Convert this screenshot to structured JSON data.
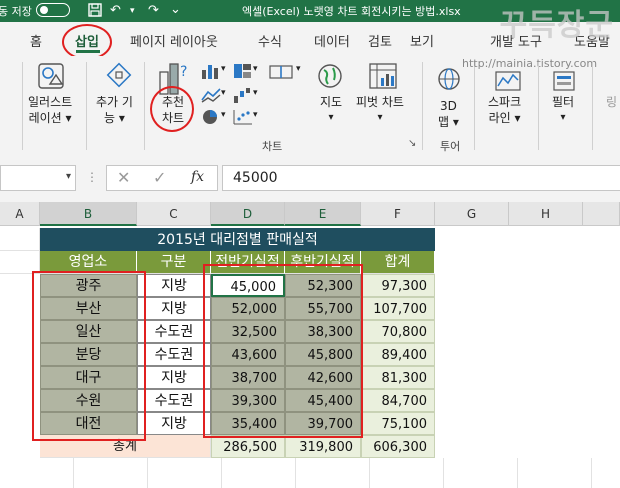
{
  "titlebar": {
    "autosave": "동 저장",
    "doc_title": "엑셀(Excel) 노랫영 차트 회전시키는 방법.xlsx"
  },
  "watermark": {
    "big": "꾸득장군",
    "url": "http://mainia.tistory.com"
  },
  "tabs": [
    "홈",
    "삽입",
    "페이지 레이아웃",
    "수식",
    "데이터",
    "검토",
    "보기",
    "개발 도구",
    "도움말"
  ],
  "ribbon": {
    "illustrations": [
      "일러스트",
      "레이션 ▾"
    ],
    "addins": [
      "추가 기",
      "능 ▾"
    ],
    "recommended": [
      "추천",
      "차트"
    ],
    "maps": [
      "지도",
      "▾"
    ],
    "pivot": [
      "피벗 차트",
      "▾"
    ],
    "map3d": [
      "3D",
      "맵 ▾"
    ],
    "sparkline": [
      "스파크",
      "라인 ▾"
    ],
    "filter": [
      "필터",
      "▾"
    ],
    "link": [
      "링"
    ],
    "group_chart": "차트",
    "group_tour": "투어",
    "dialog_launcher": "↘"
  },
  "formula_bar": {
    "fx": "fx",
    "value": "45000"
  },
  "grid": {
    "columns": [
      "A",
      "B",
      "C",
      "D",
      "E",
      "F",
      "G",
      "H"
    ],
    "title": "2015년 대리점별 판매실적",
    "headers": [
      "영업소",
      "구분",
      "전반기실적",
      "후반기실적",
      "합계"
    ],
    "rows": [
      [
        "광주",
        "지방",
        "45,000",
        "52,300",
        "97,300"
      ],
      [
        "부산",
        "지방",
        "52,000",
        "55,700",
        "107,700"
      ],
      [
        "일산",
        "수도권",
        "32,500",
        "38,300",
        "70,800"
      ],
      [
        "분당",
        "수도권",
        "43,600",
        "45,800",
        "89,400"
      ],
      [
        "대구",
        "지방",
        "38,700",
        "42,600",
        "81,300"
      ],
      [
        "수원",
        "수도권",
        "39,300",
        "45,400",
        "84,700"
      ],
      [
        "대전",
        "지방",
        "35,400",
        "39,700",
        "75,100"
      ]
    ],
    "total": [
      "총계",
      "286,500",
      "319,800",
      "606,300"
    ]
  }
}
